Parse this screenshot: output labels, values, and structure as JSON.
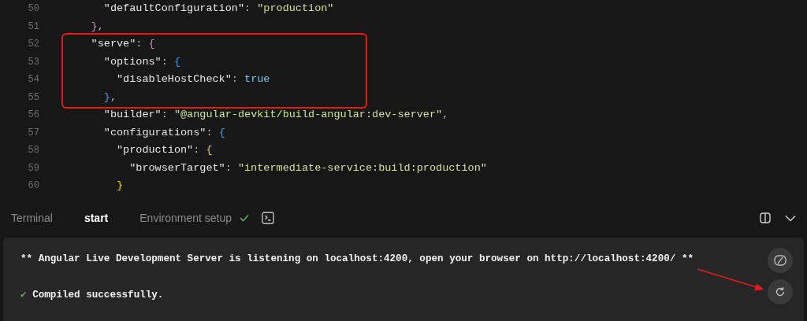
{
  "editor": {
    "lines": [
      {
        "number": "50",
        "highlighted": false,
        "tokens": [
          {
            "kind": "key",
            "text": "\"defaultConfiguration\""
          },
          {
            "kind": "punct",
            "text": ": "
          },
          {
            "kind": "string",
            "text": "\"production\""
          }
        ]
      },
      {
        "number": "51",
        "highlighted": false,
        "tokens": [
          {
            "kind": "brace",
            "color": "#c586c0",
            "text": "}"
          },
          {
            "kind": "punct",
            "text": ","
          }
        ]
      },
      {
        "number": "52",
        "highlighted": true,
        "tokens": [
          {
            "kind": "key",
            "text": "\"serve\""
          },
          {
            "kind": "punct",
            "text": ": "
          },
          {
            "kind": "brace",
            "color": "#c586c0",
            "text": "{"
          }
        ]
      },
      {
        "number": "53",
        "highlighted": true,
        "tokens": [
          {
            "kind": "key",
            "text": "\"options\""
          },
          {
            "kind": "punct",
            "text": ": "
          },
          {
            "kind": "brace",
            "color": "#3b9cf0",
            "text": "{"
          }
        ]
      },
      {
        "number": "54",
        "highlighted": true,
        "tokens": [
          {
            "kind": "key",
            "text": "\"disableHostCheck\""
          },
          {
            "kind": "punct",
            "text": ": "
          },
          {
            "kind": "bool",
            "text": "true"
          }
        ]
      },
      {
        "number": "55",
        "highlighted": true,
        "tokens": [
          {
            "kind": "brace",
            "color": "#3b9cf0",
            "text": "}"
          },
          {
            "kind": "punct",
            "text": ","
          }
        ]
      },
      {
        "number": "56",
        "highlighted": false,
        "tokens": [
          {
            "kind": "key",
            "text": "\"builder\""
          },
          {
            "kind": "punct",
            "text": ": "
          },
          {
            "kind": "string",
            "text": "\"@angular-devkit/build-angular:dev-server\""
          },
          {
            "kind": "punct",
            "text": ","
          }
        ]
      },
      {
        "number": "57",
        "highlighted": false,
        "tokens": [
          {
            "kind": "key",
            "text": "\"configurations\""
          },
          {
            "kind": "punct",
            "text": ": "
          },
          {
            "kind": "brace",
            "color": "#3b9cf0",
            "text": "{"
          }
        ]
      },
      {
        "number": "58",
        "highlighted": false,
        "tokens": [
          {
            "kind": "key",
            "text": "\"production\""
          },
          {
            "kind": "punct",
            "text": ": "
          },
          {
            "kind": "brace",
            "color": "#f1d700",
            "text": "{"
          }
        ]
      },
      {
        "number": "59",
        "highlighted": false,
        "tokens": [
          {
            "kind": "key",
            "text": "\"browserTarget\""
          },
          {
            "kind": "punct",
            "text": ": "
          },
          {
            "kind": "string",
            "text": "\"intermediate-service:build:production\""
          }
        ]
      },
      {
        "number": "60",
        "highlighted": false,
        "tokens": [
          {
            "kind": "brace",
            "color": "#f1d700",
            "text": "}"
          }
        ]
      }
    ]
  },
  "tabs": [
    {
      "label": "Terminal",
      "selected": false,
      "done": false
    },
    {
      "label": "start",
      "selected": true,
      "done": false
    },
    {
      "label": "Environment setup",
      "selected": false,
      "done": true
    }
  ],
  "terminal": {
    "lines": [
      {
        "kind": "text",
        "text": "** Angular Live Development Server is listening on localhost:4200, open your browser on http://localhost:4200/ **"
      },
      {
        "kind": "blank"
      },
      {
        "kind": "success",
        "mark": "✔",
        "text": "Compiled successfully."
      }
    ],
    "actions": [
      {
        "kind": "clear",
        "pointed": false
      },
      {
        "kind": "restart",
        "pointed": true
      }
    ]
  }
}
